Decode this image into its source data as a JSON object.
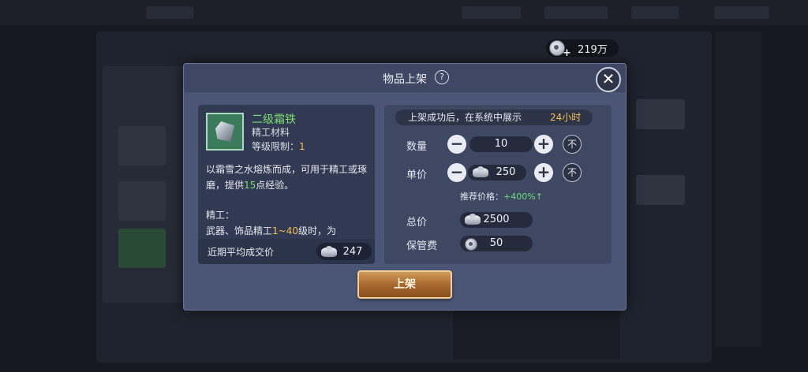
{
  "currency": {
    "amount": "219万"
  },
  "dialog": {
    "title": "物品上架",
    "help_symbol": "?",
    "close_symbol": "✕",
    "submit_label": "上架"
  },
  "item": {
    "name": "二级霜铁",
    "type": "精工材料",
    "level_label": "等级限制：",
    "level_value": "1",
    "desc_a": "以霜雪之水熔炼而成，可用于精工或琢磨，提供",
    "desc_exp": "15",
    "desc_b": "点经验。",
    "refine_title": "精工：",
    "refine_a": "武器、饰品精工",
    "refine_range": "1~40",
    "refine_b": "级时，为",
    "avg_label": "近期平均成交价",
    "avg_value": "247"
  },
  "listing": {
    "banner_text": "上架成功后，在系统中展示",
    "banner_duration": "24小时",
    "quantity_label": "数量",
    "quantity_value": "10",
    "price_label": "单价",
    "price_value": "250",
    "minus": "−",
    "plus": "+",
    "max": "不",
    "rec_label": "推荐价格：",
    "rec_value": "+400%",
    "rec_arrow": "↑",
    "total_label": "总价",
    "total_value": "2500",
    "fee_label": "保管费",
    "fee_value": "50"
  },
  "colors": {
    "item_name": "#7ddf6e",
    "highlight_gold": "#f2c14e",
    "button_bronze": "#a5652b"
  },
  "icons": {
    "currency": "silver-coin-plus-icon",
    "ingot": "silver-ingot-icon",
    "help": "question-icon",
    "close": "close-icon"
  }
}
